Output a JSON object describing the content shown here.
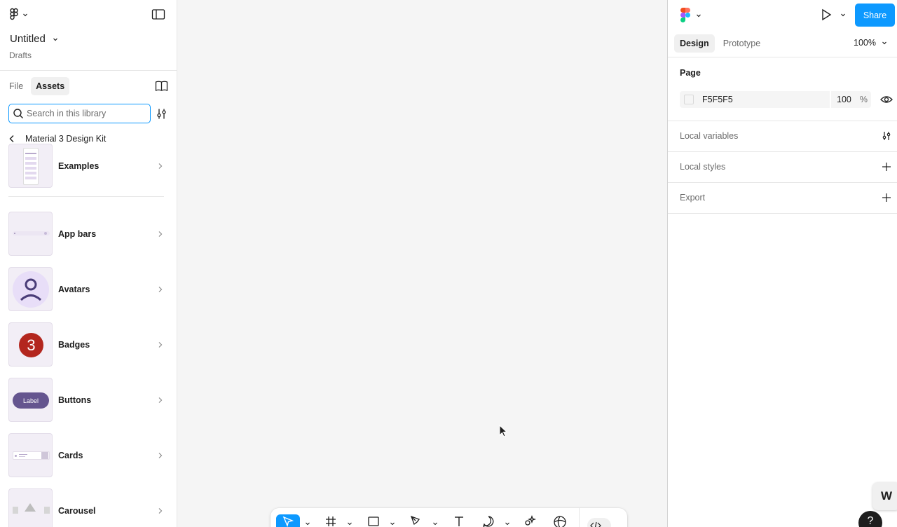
{
  "left_panel": {
    "file_title": "Untitled",
    "file_location": "Drafts",
    "tabs": [
      {
        "label": "File",
        "active": false
      },
      {
        "label": "Assets",
        "active": true
      }
    ],
    "search": {
      "placeholder": "Search in this library",
      "value": ""
    },
    "library": {
      "name": "Material 3 Design Kit"
    },
    "assets": [
      {
        "label": "Examples",
        "icon": "examples-thumbnail"
      },
      {
        "label": "App bars",
        "icon": "app-bars-thumbnail"
      },
      {
        "label": "Avatars",
        "icon": "avatar-person-thumbnail"
      },
      {
        "label": "Badges",
        "icon": "badge-thumbnail",
        "badge_text": "3"
      },
      {
        "label": "Buttons",
        "icon": "button-thumbnail",
        "button_text": "Label"
      },
      {
        "label": "Cards",
        "icon": "cards-thumbnail"
      },
      {
        "label": "Carousel",
        "icon": "carousel-thumbnail"
      }
    ]
  },
  "right_panel": {
    "share_label": "Share",
    "tabs": [
      {
        "label": "Design",
        "active": true
      },
      {
        "label": "Prototype",
        "active": false
      }
    ],
    "zoom": "100%",
    "page": {
      "title": "Page",
      "fill_hex": "F5F5F5",
      "opacity": "100",
      "opacity_unit": "%"
    },
    "sections": [
      {
        "label": "Local variables",
        "icon": "adjust-icon"
      },
      {
        "label": "Local styles",
        "icon": "plus-icon"
      },
      {
        "label": "Export",
        "icon": "plus-icon"
      }
    ]
  },
  "toolbar": {
    "tools": [
      "move-tool",
      "frame-tool",
      "rectangle-tool",
      "pen-tool",
      "text-tool",
      "comment-tool",
      "actions-tool",
      "devmode-tool"
    ],
    "active": "move-tool"
  },
  "colors": {
    "accent": "#0d99ff",
    "canvas": "#f5f5f5",
    "badge_red": "#b3261e",
    "button_purple": "#65558f"
  },
  "misc": {
    "help_label": "?",
    "w_badge": "W"
  }
}
